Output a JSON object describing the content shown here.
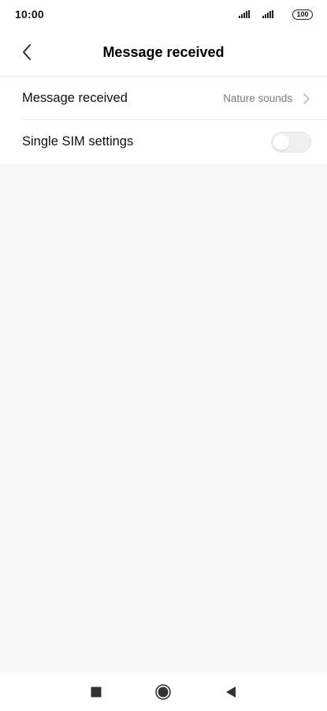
{
  "status_bar": {
    "time": "10:00",
    "battery": "100",
    "icons": [
      "signal-icon",
      "signal-icon",
      "battery-icon"
    ]
  },
  "header": {
    "title": "Message received",
    "back_icon": "back-arrow-icon"
  },
  "settings": {
    "message_received": {
      "label": "Message received",
      "value": "Nature sounds",
      "icon": "chevron-right-icon"
    },
    "single_sim": {
      "label": "Single SIM settings",
      "toggle_on": false
    }
  },
  "nav_bar": {
    "icons": [
      "recents-icon",
      "home-icon",
      "back-icon"
    ]
  },
  "colors": {
    "background": "#f7f7f7",
    "surface": "#ffffff",
    "secondary_text": "#7a7a7a"
  }
}
